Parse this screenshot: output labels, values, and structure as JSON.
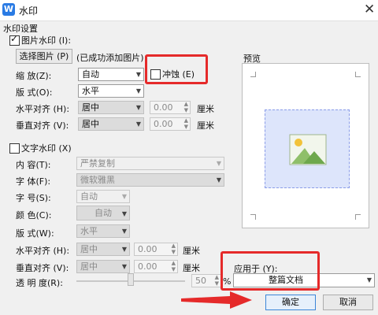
{
  "window": {
    "title": "水印",
    "icon": "W"
  },
  "section_title": "水印设置",
  "picture_watermark": {
    "checkbox_label": "图片水印 (I):",
    "checked": true,
    "select_button": "选择图片 (P)",
    "status": "(已成功添加图片)",
    "scale_label": "缩    放(Z):",
    "scale_value": "自动",
    "washout_label": "冲蚀 (E)",
    "washout_checked": false,
    "layout_label": "版    式(O):",
    "layout_value": "水平",
    "halign_label": "水平对齐 (H):",
    "halign_value": "居中",
    "halign_offset": "0.00",
    "valign_label": "垂直对齐 (V):",
    "valign_value": "居中",
    "valign_offset": "0.00",
    "unit": "厘米"
  },
  "text_watermark": {
    "checkbox_label": "文字水印 (X)",
    "checked": false,
    "content_label": "内    容(T):",
    "content_value": "严禁复制",
    "font_label": "字    体(F):",
    "font_value": "微软雅黑",
    "size_label": "字    号(S):",
    "size_value": "自动",
    "color_label": "颜    色(C):",
    "color_value": "自动",
    "layout_label": "版    式(W):",
    "layout_value": "水平",
    "halign_label": "水平对齐 (H):",
    "halign_value": "居中",
    "halign_offset": "0.00",
    "valign_label": "垂直对齐 (V):",
    "valign_value": "居中",
    "valign_offset": "0.00",
    "unit": "厘米",
    "transparency_label": "透  明  度(R):",
    "transparency_value": "50",
    "transparency_unit": "%"
  },
  "preview": {
    "label": "预览"
  },
  "apply_to": {
    "label": "应用于 (Y):",
    "value": "整篇文档"
  },
  "buttons": {
    "ok": "确定",
    "cancel": "取消"
  },
  "colors": {
    "highlight": "#e52a2a",
    "preview_fill": "#dde5fb",
    "accent": "#2a7be4"
  }
}
